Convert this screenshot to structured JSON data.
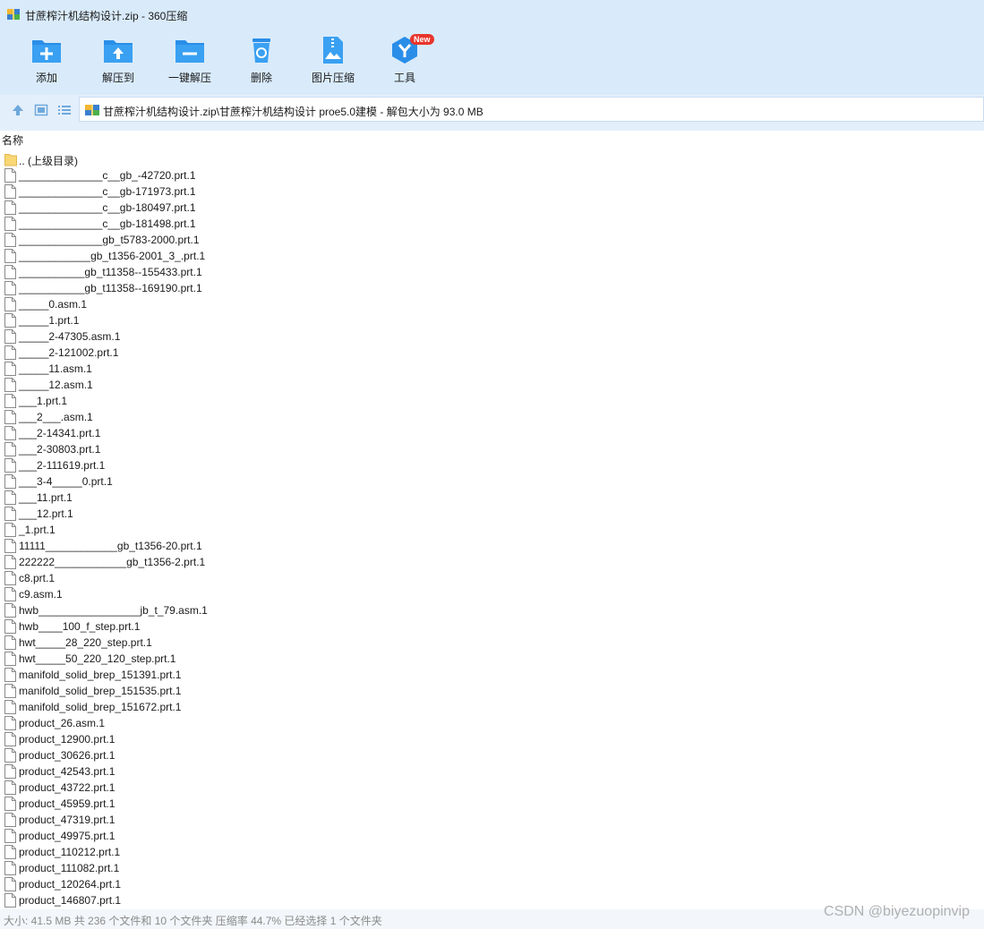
{
  "window": {
    "title": "甘蔗榨汁机结构设计.zip - 360压缩"
  },
  "toolbar": {
    "items": [
      {
        "label": "添加",
        "icon": "add-icon"
      },
      {
        "label": "解压到",
        "icon": "extract-to-icon"
      },
      {
        "label": "一键解压",
        "icon": "one-click-extract-icon"
      },
      {
        "label": "删除",
        "icon": "delete-icon"
      },
      {
        "label": "图片压缩",
        "icon": "image-compress-icon"
      },
      {
        "label": "工具",
        "icon": "tools-icon",
        "badge": "New"
      }
    ]
  },
  "address": {
    "path": "甘蔗榨汁机结构设计.zip\\甘蔗榨汁机结构设计 proe5.0建模 - 解包大小为 93.0 MB"
  },
  "list": {
    "column_name": "名称",
    "files": [
      {
        "name": ".. (上级目录)",
        "type": "folder"
      },
      {
        "name": "______________c__gb_-42720.prt.1",
        "type": "file"
      },
      {
        "name": "______________c__gb-171973.prt.1",
        "type": "file"
      },
      {
        "name": "______________c__gb-180497.prt.1",
        "type": "file"
      },
      {
        "name": "______________c__gb-181498.prt.1",
        "type": "file"
      },
      {
        "name": "______________gb_t5783-2000.prt.1",
        "type": "file"
      },
      {
        "name": "____________gb_t1356-2001_3_.prt.1",
        "type": "file"
      },
      {
        "name": "___________gb_t11358--155433.prt.1",
        "type": "file"
      },
      {
        "name": "___________gb_t11358--169190.prt.1",
        "type": "file"
      },
      {
        "name": "_____0.asm.1",
        "type": "file"
      },
      {
        "name": "_____1.prt.1",
        "type": "file"
      },
      {
        "name": "_____2-47305.asm.1",
        "type": "file"
      },
      {
        "name": "_____2-121002.prt.1",
        "type": "file"
      },
      {
        "name": "_____11.asm.1",
        "type": "file"
      },
      {
        "name": "_____12.asm.1",
        "type": "file"
      },
      {
        "name": "___1.prt.1",
        "type": "file"
      },
      {
        "name": "___2___.asm.1",
        "type": "file"
      },
      {
        "name": "___2-14341.prt.1",
        "type": "file"
      },
      {
        "name": "___2-30803.prt.1",
        "type": "file"
      },
      {
        "name": "___2-111619.prt.1",
        "type": "file"
      },
      {
        "name": "___3-4_____0.prt.1",
        "type": "file"
      },
      {
        "name": "___11.prt.1",
        "type": "file"
      },
      {
        "name": "___12.prt.1",
        "type": "file"
      },
      {
        "name": "_1.prt.1",
        "type": "file"
      },
      {
        "name": "11111____________gb_t1356-20.prt.1",
        "type": "file"
      },
      {
        "name": "222222____________gb_t1356-2.prt.1",
        "type": "file"
      },
      {
        "name": "c8.prt.1",
        "type": "file"
      },
      {
        "name": "c9.asm.1",
        "type": "file"
      },
      {
        "name": "hwb_________________jb_t_79.asm.1",
        "type": "file"
      },
      {
        "name": "hwb____100_f_step.prt.1",
        "type": "file"
      },
      {
        "name": "hwt_____28_220_step.prt.1",
        "type": "file"
      },
      {
        "name": "hwt_____50_220_120_step.prt.1",
        "type": "file"
      },
      {
        "name": "manifold_solid_brep_151391.prt.1",
        "type": "file"
      },
      {
        "name": "manifold_solid_brep_151535.prt.1",
        "type": "file"
      },
      {
        "name": "manifold_solid_brep_151672.prt.1",
        "type": "file"
      },
      {
        "name": "product_26.asm.1",
        "type": "file"
      },
      {
        "name": "product_12900.prt.1",
        "type": "file"
      },
      {
        "name": "product_30626.prt.1",
        "type": "file"
      },
      {
        "name": "product_42543.prt.1",
        "type": "file"
      },
      {
        "name": "product_43722.prt.1",
        "type": "file"
      },
      {
        "name": "product_45959.prt.1",
        "type": "file"
      },
      {
        "name": "product_47319.prt.1",
        "type": "file"
      },
      {
        "name": "product_49975.prt.1",
        "type": "file"
      },
      {
        "name": "product_110212.prt.1",
        "type": "file"
      },
      {
        "name": "product_111082.prt.1",
        "type": "file"
      },
      {
        "name": "product_120264.prt.1",
        "type": "file"
      },
      {
        "name": "product_146807.prt.1",
        "type": "file"
      }
    ]
  },
  "status": {
    "text": "大小: 41.5 MB 共 236 个文件和 10 个文件夹 压缩率 44.7% 已经选择 1 个文件夹",
    "watermark": "CSDN @biyezuopinvip"
  },
  "colors": {
    "toolbar_bg": "#d9ebfb",
    "icon_blue": "#2a8ee8",
    "badge_red": "#e8352b"
  }
}
